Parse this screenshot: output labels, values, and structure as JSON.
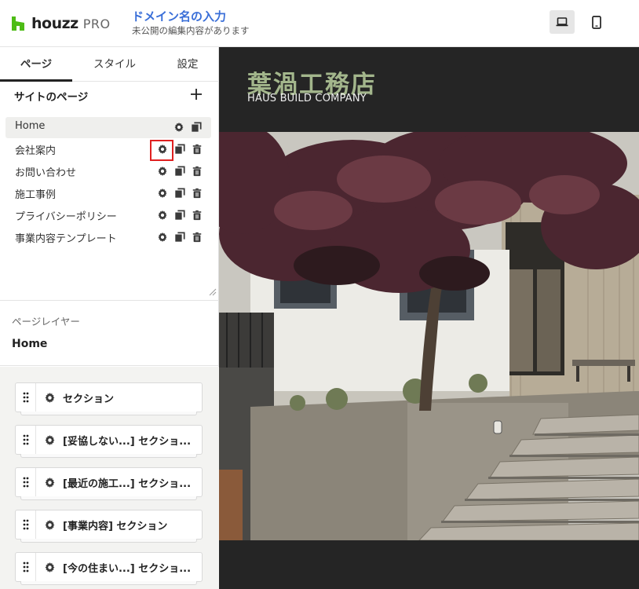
{
  "header": {
    "logo_text": "houzz",
    "logo_pro": "PRO",
    "domain_title": "ドメイン名の入力",
    "domain_subtitle": "未公開の編集内容があります",
    "device_icons": [
      "desktop-icon",
      "mobile-icon"
    ]
  },
  "tabs": [
    {
      "label": "ページ",
      "active": true
    },
    {
      "label": "スタイル",
      "active": false
    },
    {
      "label": "設定",
      "active": false
    }
  ],
  "site_pages": {
    "heading": "サイトのページ",
    "add_icon": "plus-icon",
    "items": [
      {
        "label": "Home",
        "active": true
      },
      {
        "label": "会社案内",
        "active": false,
        "highlighted_icon": "gear-icon"
      },
      {
        "label": "お問い合わせ",
        "active": false
      },
      {
        "label": "施工事例",
        "active": false
      },
      {
        "label": "プライバシーポリシー",
        "active": false
      },
      {
        "label": "事業内容テンプレート",
        "active": false
      }
    ]
  },
  "page_layer": {
    "label": "ページレイヤー",
    "name": "Home"
  },
  "sections": [
    {
      "title": "セクション"
    },
    {
      "title": "[妥協しない...] セクショ..."
    },
    {
      "title": "[最近の施工...] セクショ..."
    },
    {
      "title": "[事業内容] セクション"
    },
    {
      "title": "[今の住まい...] セクショ..."
    }
  ],
  "preview": {
    "site_title": "葉渦工務店",
    "site_subtitle": "HAUS BUILD COMPANY",
    "title_color": "#a3b68c",
    "background_color": "#252525"
  },
  "colors": {
    "accent": "#3a6fd8",
    "brand": "#4dbc15",
    "highlight": "#e02020"
  }
}
